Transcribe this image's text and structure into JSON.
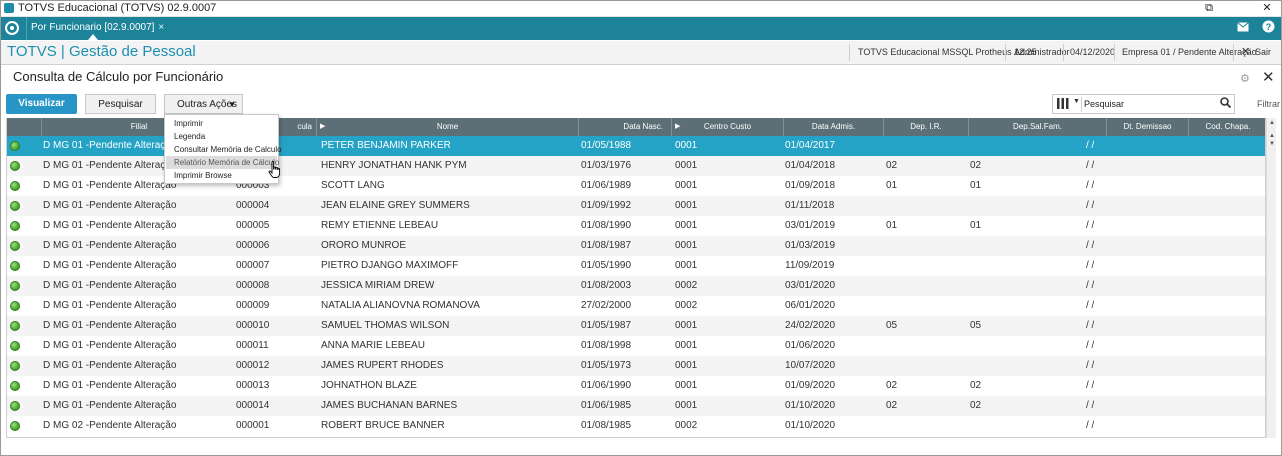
{
  "window": {
    "title": "TOTVS Educacional (TOTVS) 02.9.0007",
    "restore_label": "⧉",
    "close_label": "✕"
  },
  "tabs": [
    {
      "label": "Por Funcionario [02.9.0007]",
      "close": "×"
    }
  ],
  "module": {
    "title": "TOTVS | Gestão de Pessoal",
    "environment": "TOTVS Educacional MSSQL Protheus 12.25",
    "user": "Administrador",
    "date": "04/12/2020",
    "company": "Empresa 01 / Pendente Alteração",
    "exit_label": "Sair"
  },
  "page": {
    "title": "Consulta de Cálculo por Funcionário"
  },
  "toolbar": {
    "visualizar": "Visualizar",
    "pesquisar": "Pesquisar",
    "outras_acoes": "Outras Ações",
    "search_value": "Pesquisar",
    "filtrar": "Filtrar"
  },
  "menu": {
    "items": [
      "Imprimir",
      "Legenda",
      "Consultar Memória de Calculo",
      "Relatório Memória de Cálculo",
      "Imprimir Browse"
    ],
    "highlighted_index": 3
  },
  "grid": {
    "headers": [
      "Filial",
      "Matricula",
      "Nome",
      "Data Nasc.",
      "Centro Custo",
      "Data Admis.",
      "Dep. I.R.",
      "Dep.Sal.Fam.",
      "Dt. Demissao",
      "Cod. Chapa"
    ],
    "header_visible": {
      "filial": "Filial",
      "matricula": "cula",
      "nome": "Nome",
      "data_nasc": "Data Nasc.",
      "centro_custo": "Centro Custo",
      "data_admis": "Data Admis.",
      "dep_ir": "Dep. I.R.",
      "dep_sal": "Dep.Sal.Fam.",
      "dt_demissao": "Dt. Demissao",
      "cod_chapa": "Cod. Chapa."
    },
    "selected_index": 0,
    "status_color": "#3fa02a",
    "rows": [
      {
        "filial": "D MG 01 -Pendente Alteração",
        "matricula": "000001",
        "nome": "PETER BENJAMIN PARKER",
        "nasc": "01/05/1988",
        "cc": "0001",
        "admis": "01/04/2017",
        "dep_ir": "",
        "dep_sal": "",
        "demissao": "/ /"
      },
      {
        "filial": "D MG 01 -Pendente Alteração",
        "matricula": "000002",
        "nome": "HENRY JONATHAN HANK PYM",
        "nasc": "01/03/1976",
        "cc": "0001",
        "admis": "01/04/2018",
        "dep_ir": "02",
        "dep_sal": "02",
        "demissao": "/ /"
      },
      {
        "filial": "D MG 01 -Pendente Alteração",
        "matricula": "000003",
        "nome": "SCOTT LANG",
        "nasc": "01/06/1989",
        "cc": "0001",
        "admis": "01/09/2018",
        "dep_ir": "01",
        "dep_sal": "01",
        "demissao": "/ /"
      },
      {
        "filial": "D MG 01 -Pendente Alteração",
        "matricula": "000004",
        "nome": "JEAN ELAINE GREY SUMMERS",
        "nasc": "01/09/1992",
        "cc": "0001",
        "admis": "01/11/2018",
        "dep_ir": "",
        "dep_sal": "",
        "demissao": "/ /"
      },
      {
        "filial": "D MG 01 -Pendente Alteração",
        "matricula": "000005",
        "nome": "REMY ETIENNE LEBEAU",
        "nasc": "01/08/1990",
        "cc": "0001",
        "admis": "03/01/2019",
        "dep_ir": "01",
        "dep_sal": "01",
        "demissao": "/ /"
      },
      {
        "filial": "D MG 01 -Pendente Alteração",
        "matricula": "000006",
        "nome": "ORORO MUNROE",
        "nasc": "01/08/1987",
        "cc": "0001",
        "admis": "01/03/2019",
        "dep_ir": "",
        "dep_sal": "",
        "demissao": "/ /"
      },
      {
        "filial": "D MG 01 -Pendente Alteração",
        "matricula": "000007",
        "nome": "PIETRO DJANGO MAXIMOFF",
        "nasc": "01/05/1990",
        "cc": "0001",
        "admis": "11/09/2019",
        "dep_ir": "",
        "dep_sal": "",
        "demissao": "/ /"
      },
      {
        "filial": "D MG 01 -Pendente Alteração",
        "matricula": "000008",
        "nome": "JESSICA MIRIAM DREW",
        "nasc": "01/08/2003",
        "cc": "0002",
        "admis": "03/01/2020",
        "dep_ir": "",
        "dep_sal": "",
        "demissao": "/ /"
      },
      {
        "filial": "D MG 01 -Pendente Alteração",
        "matricula": "000009",
        "nome": "NATALIA ALIANOVNA ROMANOVA",
        "nasc": "27/02/2000",
        "cc": "0002",
        "admis": "06/01/2020",
        "dep_ir": "",
        "dep_sal": "",
        "demissao": "/ /"
      },
      {
        "filial": "D MG 01 -Pendente Alteração",
        "matricula": "000010",
        "nome": "SAMUEL THOMAS WILSON",
        "nasc": "01/05/1987",
        "cc": "0001",
        "admis": "24/02/2020",
        "dep_ir": "05",
        "dep_sal": "05",
        "demissao": "/ /"
      },
      {
        "filial": "D MG 01 -Pendente Alteração",
        "matricula": "000011",
        "nome": "ANNA MARIE LEBEAU",
        "nasc": "01/08/1998",
        "cc": "0001",
        "admis": "01/06/2020",
        "dep_ir": "",
        "dep_sal": "",
        "demissao": "/ /"
      },
      {
        "filial": "D MG 01 -Pendente Alteração",
        "matricula": "000012",
        "nome": "JAMES RUPERT RHODES",
        "nasc": "01/05/1973",
        "cc": "0001",
        "admis": "10/07/2020",
        "dep_ir": "",
        "dep_sal": "",
        "demissao": "/ /"
      },
      {
        "filial": "D MG 01 -Pendente Alteração",
        "matricula": "000013",
        "nome": "JOHNATHON BLAZE",
        "nasc": "01/06/1990",
        "cc": "0001",
        "admis": "01/09/2020",
        "dep_ir": "02",
        "dep_sal": "02",
        "demissao": "/ /"
      },
      {
        "filial": "D MG 01 -Pendente Alteração",
        "matricula": "000014",
        "nome": "JAMES BUCHANAN BARNES",
        "nasc": "01/06/1985",
        "cc": "0001",
        "admis": "01/10/2020",
        "dep_ir": "02",
        "dep_sal": "02",
        "demissao": "/ /"
      },
      {
        "filial": "D MG 02 -Pendente Alteração",
        "matricula": "000001",
        "nome": "ROBERT BRUCE BANNER",
        "nasc": "01/08/1985",
        "cc": "0002",
        "admis": "01/10/2020",
        "dep_ir": "",
        "dep_sal": "",
        "demissao": "/ /"
      }
    ]
  }
}
